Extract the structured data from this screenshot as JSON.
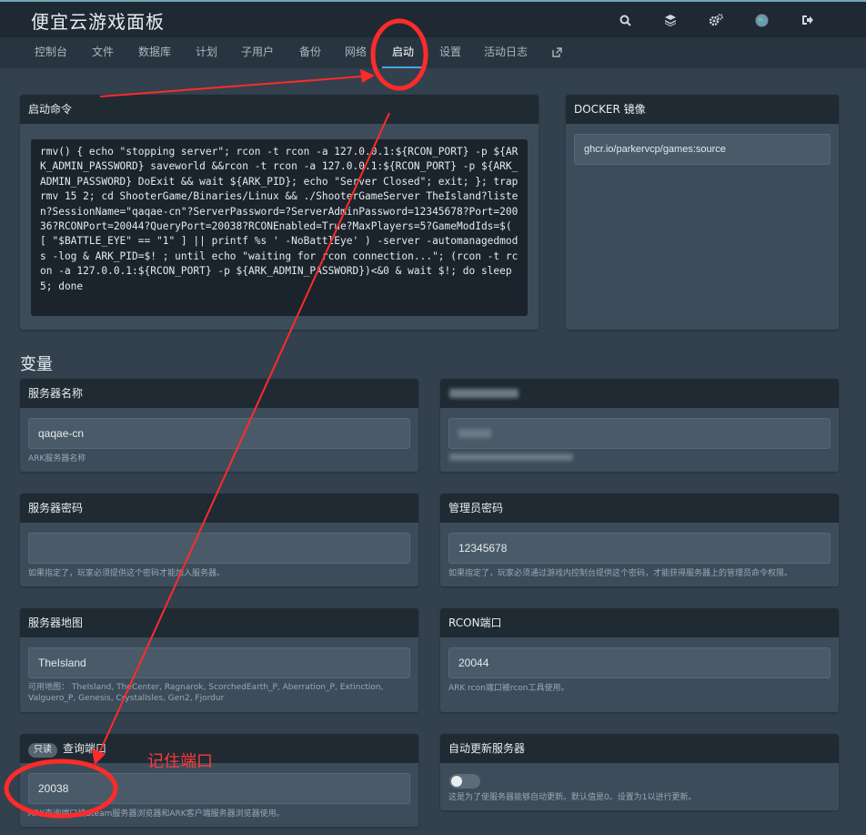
{
  "app": {
    "title": "便宜云游戏面板"
  },
  "top_icons": [
    "search-icon",
    "layers-icon",
    "cogs-icon",
    "avatar-icon",
    "logout-icon"
  ],
  "nav": {
    "items": [
      "控制台",
      "文件",
      "数据库",
      "计划",
      "子用户",
      "备份",
      "网络",
      "启动",
      "设置",
      "活动日志"
    ],
    "active": "启动",
    "external_icon": "external-link-icon"
  },
  "startup": {
    "title": "启动命令",
    "command": "rmv() { echo \"stopping server\"; rcon -t rcon -a 127.0.0.1:${RCON_PORT} -p ${ARK_ADMIN_PASSWORD} saveworld &&rcon -t rcon -a 127.0.0.1:${RCON_PORT} -p ${ARK_ADMIN_PASSWORD} DoExit && wait ${ARK_PID}; echo \"Server Closed\"; exit; }; trap rmv 15 2; cd ShooterGame/Binaries/Linux && ./ShooterGameServer TheIsland?listen?SessionName=\"qaqae-cn\"?ServerPassword=?ServerAdminPassword=12345678?Port=20036?RCONPort=20044?QueryPort=20038?RCONEnabled=True?MaxPlayers=5?GameModIds=$( [ \"$BATTLE_EYE\" == \"1\" ] || printf %s ' -NoBattlEye' ) -server -automanagedmods -log & ARK_PID=$! ; until echo \"waiting for rcon connection...\"; (rcon -t rcon -a 127.0.0.1:${RCON_PORT} -p ${ARK_ADMIN_PASSWORD})<&0 & wait $!; do sleep 5; done"
  },
  "docker": {
    "title": "DOCKER 镜像",
    "image": "ghcr.io/parkervcp/games:source"
  },
  "variables": {
    "title": "变量",
    "server_name": {
      "label": "服务器名称",
      "value": "qaqae-cn",
      "hint": "ARK服务器名称"
    },
    "server_password": {
      "label": "服务器密码",
      "value": "",
      "hint": "如果指定了，玩家必须提供这个密码才能加入服务器。"
    },
    "admin_password": {
      "label": "管理员密码",
      "value": "12345678",
      "hint": "如果指定了，玩家必须通过游戏内控制台提供这个密码，才能获得服务器上的管理员命令权限。"
    },
    "server_map": {
      "label": "服务器地图",
      "value": "TheIsland",
      "hint": "可用地图： TheIsland, TheCenter, Ragnarok, ScorchedEarth_P, Aberration_P, Extinction, Valguero_P, Genesis, CrystalIsles, Gen2, Fjordur"
    },
    "rcon_port": {
      "label": "RCON端口",
      "value": "20044",
      "hint": "ARK rcon端口被rcon工具使用。"
    },
    "query_port": {
      "label": "查询端口",
      "badge": "只读",
      "value": "20038",
      "hint": "ARK查询端口被Steam服务器浏览器和ARK客户端服务器浏览器使用。"
    },
    "auto_update": {
      "label": "自动更新服务器",
      "enabled": false,
      "hint": "这是为了使服务器能够自动更新。默认值是0。设置为1以进行更新。"
    }
  },
  "annotation": {
    "text": "记住端口",
    "color": "#ff3a3a"
  }
}
